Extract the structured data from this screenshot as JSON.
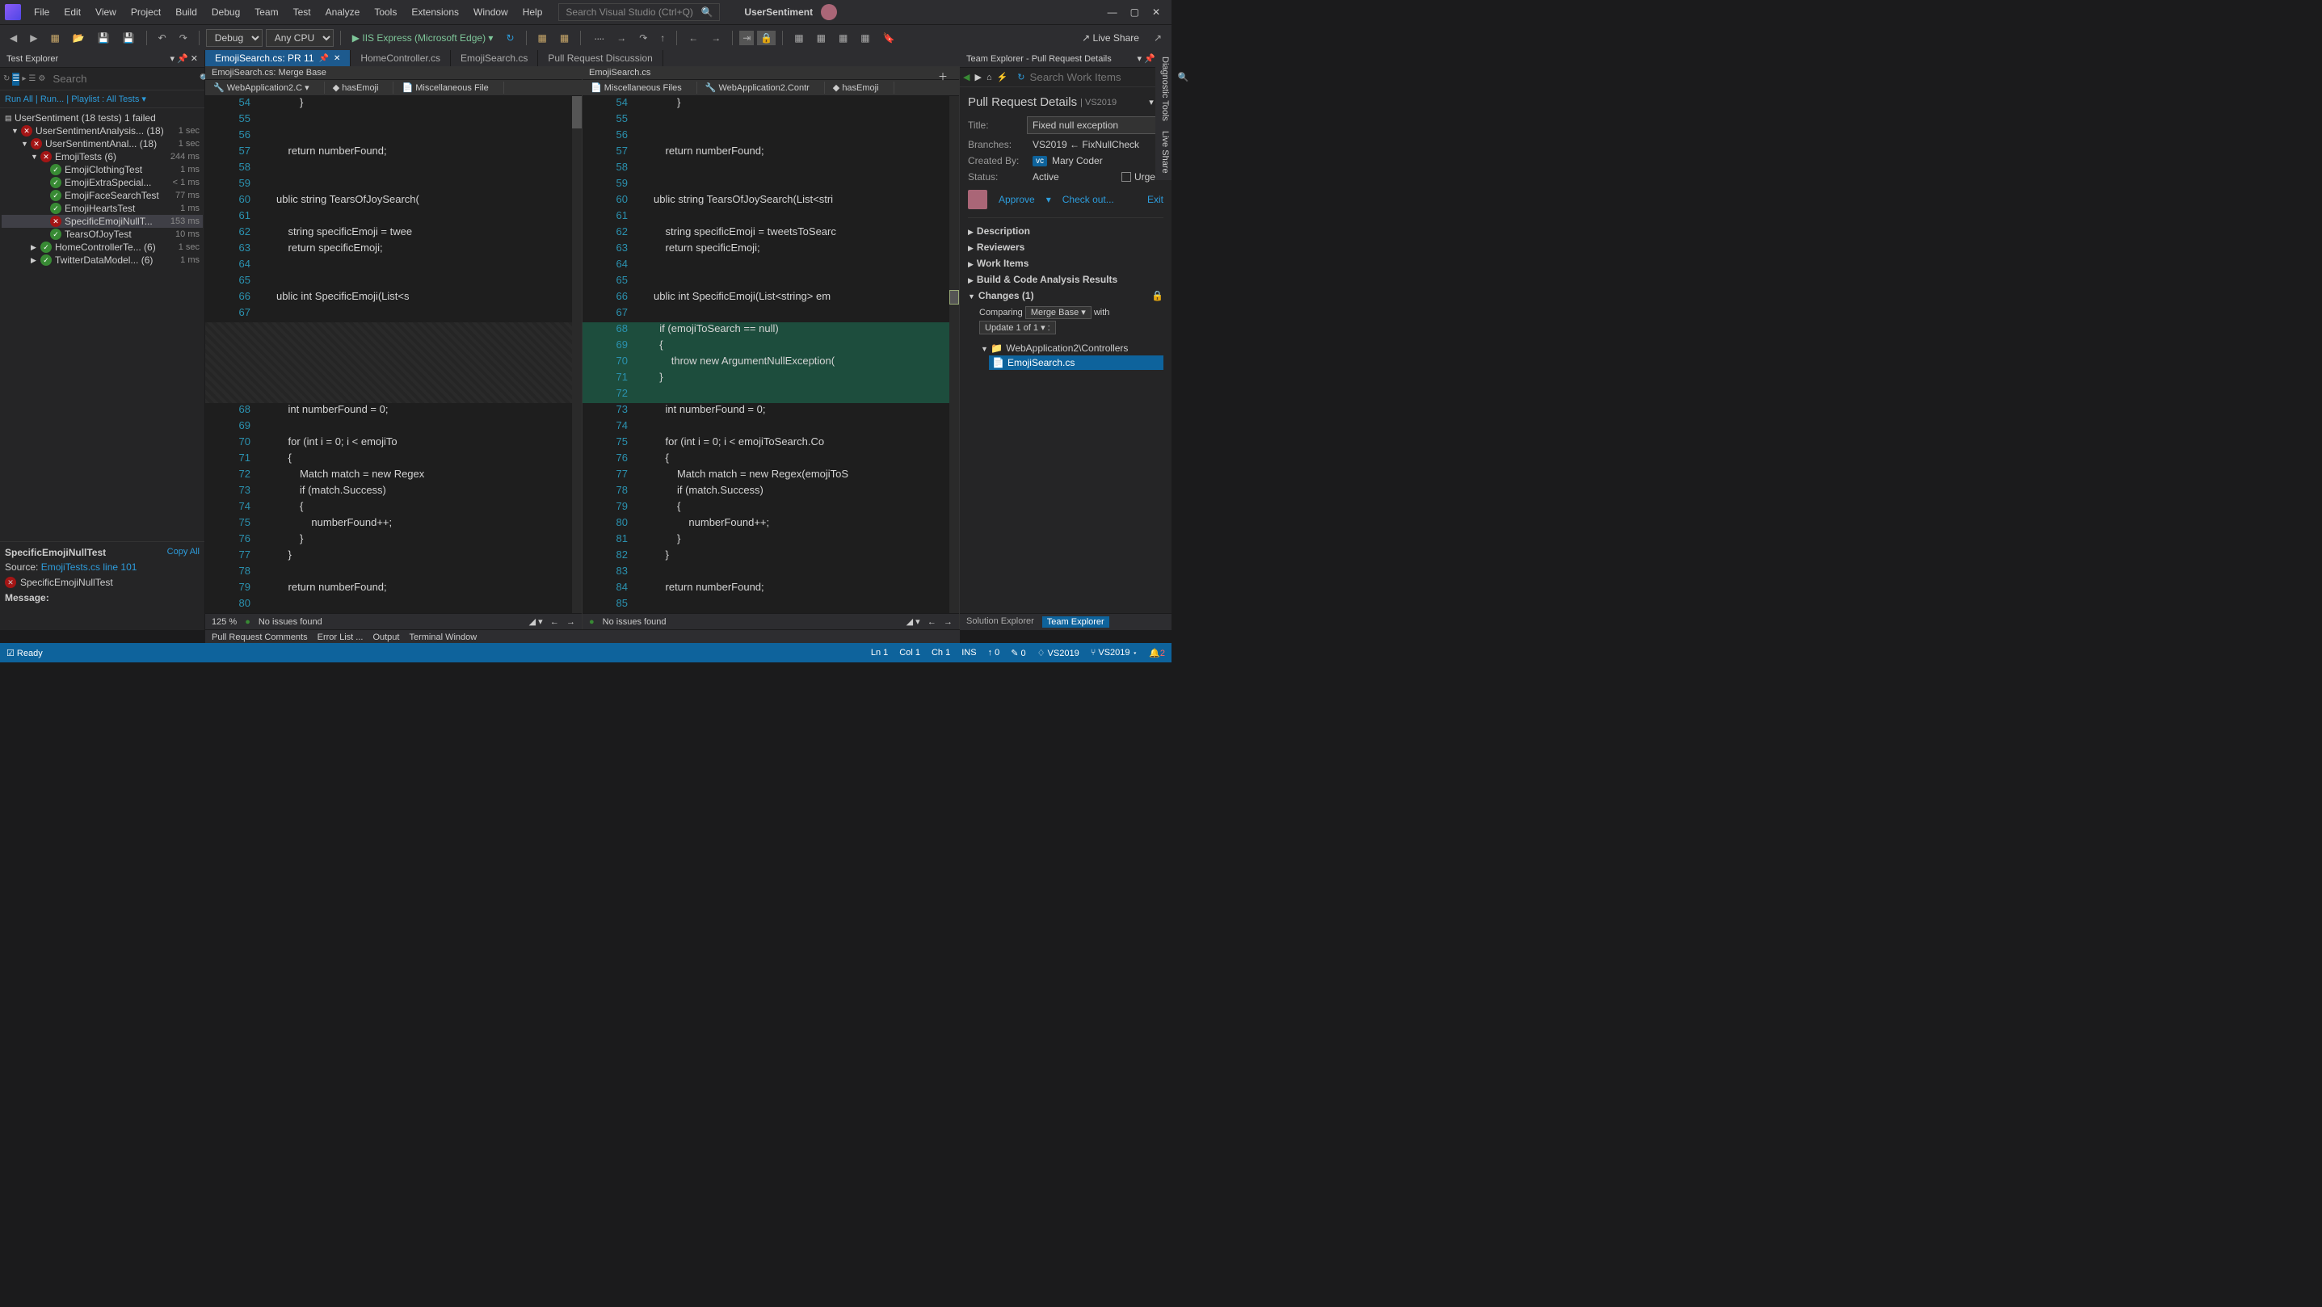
{
  "titlebar": {
    "menus": [
      "File",
      "Edit",
      "View",
      "Project",
      "Build",
      "Debug",
      "Team",
      "Test",
      "Analyze",
      "Tools",
      "Extensions",
      "Window",
      "Help"
    ],
    "search_placeholder": "Search Visual Studio (Ctrl+Q)",
    "project": "UserSentiment",
    "win_min": "—",
    "win_max": "▢",
    "win_close": "✕"
  },
  "toolbar": {
    "config": "Debug",
    "platform": "Any CPU",
    "start": "▶  IIS Express (Microsoft Edge)  ▾",
    "live_share": "↗ Live Share"
  },
  "test_explorer": {
    "title": "Test Explorer",
    "search_placeholder": "Search",
    "links": {
      "run_all": "Run All",
      "run": "Run...",
      "playlist": "Playlist : All Tests ▾"
    },
    "root": {
      "name": "UserSentiment (18 tests) 1 failed"
    },
    "nodes": [
      {
        "ind": 1,
        "exp": "▼",
        "st": "fail",
        "name": "UserSentimentAnalysis... (18)",
        "dur": "1 sec"
      },
      {
        "ind": 2,
        "exp": "▼",
        "st": "fail",
        "name": "UserSentimentAnal... (18)",
        "dur": "1 sec"
      },
      {
        "ind": 3,
        "exp": "▼",
        "st": "fail",
        "name": "EmojiTests (6)",
        "dur": "244 ms"
      },
      {
        "ind": 4,
        "exp": "",
        "st": "pass",
        "name": "EmojiClothingTest",
        "dur": "1 ms"
      },
      {
        "ind": 4,
        "exp": "",
        "st": "pass",
        "name": "EmojiExtraSpecial...",
        "dur": "< 1 ms"
      },
      {
        "ind": 4,
        "exp": "",
        "st": "pass",
        "name": "EmojiFaceSearchTest",
        "dur": "77 ms"
      },
      {
        "ind": 4,
        "exp": "",
        "st": "pass",
        "name": "EmojiHeartsTest",
        "dur": "1 ms"
      },
      {
        "ind": 4,
        "exp": "",
        "st": "fail",
        "name": "SpecificEmojiNullT...",
        "dur": "153 ms",
        "sel": true
      },
      {
        "ind": 4,
        "exp": "",
        "st": "pass",
        "name": "TearsOfJoyTest",
        "dur": "10 ms"
      },
      {
        "ind": 3,
        "exp": "▶",
        "st": "pass",
        "name": "HomeControllerTe... (6)",
        "dur": "1 sec"
      },
      {
        "ind": 3,
        "exp": "▶",
        "st": "pass",
        "name": "TwitterDataModel... (6)",
        "dur": "1 ms"
      }
    ],
    "detail": {
      "name": "SpecificEmojiNullTest",
      "copy": "Copy All",
      "source_lbl": "Source:  ",
      "source": "EmojiTests.cs line 101",
      "fail_name": "SpecificEmojiNullTest",
      "msg_lbl": "Message:"
    }
  },
  "tabs": [
    {
      "label": "EmojiSearch.cs: PR 11",
      "active": true,
      "pin": true
    },
    {
      "label": "HomeController.cs"
    },
    {
      "label": "EmojiSearch.cs"
    },
    {
      "label": "Pull Request Discussion"
    }
  ],
  "left_pane": {
    "head": "EmojiSearch.cs: Merge Base",
    "nav": [
      "📄 Miscellaneous File",
      "🔧 WebApplication2.C ▾",
      "◆ hasEmoji"
    ],
    "lines": [
      {
        "n": 54,
        "t": "             }"
      },
      {
        "n": 55,
        "t": ""
      },
      {
        "n": 56,
        "t": ""
      },
      {
        "n": 57,
        "t": "         return numberFound;"
      },
      {
        "n": 58,
        "t": ""
      },
      {
        "n": 59,
        "t": ""
      },
      {
        "n": 60,
        "h": "     ublic <kw>string</kw> <typ>TearsOfJoySearch</typ>("
      },
      {
        "n": 61,
        "t": ""
      },
      {
        "n": 62,
        "h": "         <kw>string</kw> specificEmoji = twee"
      },
      {
        "n": 63,
        "h": "         <kw>return</kw> specificEmoji;"
      },
      {
        "n": 64,
        "t": ""
      },
      {
        "n": 65,
        "t": ""
      },
      {
        "n": 66,
        "h": "     ublic <kw>int</kw> <typ>SpecificEmoji</typ>(<typ>List</typ>&lt;s"
      },
      {
        "n": 67,
        "t": ""
      },
      {
        "gap": true
      },
      {
        "n": 68,
        "h": "         <kw>int</kw> numberFound = 0;"
      },
      {
        "n": 69,
        "t": ""
      },
      {
        "n": 70,
        "h": "         <kw>for</kw> (<kw>int</kw> i = 0; i < emojiTo"
      },
      {
        "n": 71,
        "t": "         {"
      },
      {
        "n": 72,
        "h": "             <typ>Match</typ> match = <kw>new</kw> <typ>Rege</typ>x"
      },
      {
        "n": 73,
        "h": "             <kw>if</kw> (match.Success)"
      },
      {
        "n": 74,
        "t": "             {"
      },
      {
        "n": 75,
        "t": "                 numberFound++;"
      },
      {
        "n": 76,
        "t": "             }"
      },
      {
        "n": 77,
        "t": "         }"
      },
      {
        "n": 78,
        "t": ""
      },
      {
        "n": 79,
        "h": "         <kw>return</kw> numberFound;"
      },
      {
        "n": 80,
        "t": ""
      }
    ],
    "status": {
      "zoom": "125 %",
      "issues": "No issues found"
    }
  },
  "right_pane": {
    "head": "EmojiSearch.cs",
    "nav": [
      "📄 Miscellaneous Files",
      "🔧 WebApplication2.Contr",
      "◆ hasEmoji"
    ],
    "lines": [
      {
        "n": 54,
        "t": "             }"
      },
      {
        "n": 55,
        "t": ""
      },
      {
        "n": 56,
        "t": ""
      },
      {
        "n": 57,
        "t": "         return numberFound;"
      },
      {
        "n": 58,
        "t": ""
      },
      {
        "n": 59,
        "t": ""
      },
      {
        "n": 60,
        "h": "     ublic <kw>string</kw> <typ>TearsOfJoySearch</typ>(<typ>List</typ>&lt;stri"
      },
      {
        "n": 61,
        "t": ""
      },
      {
        "n": 62,
        "h": "         <kw>string</kw> specificEmoji = tweetsToSearc"
      },
      {
        "n": 63,
        "h": "         <kw>return</kw> specificEmoji;"
      },
      {
        "n": 64,
        "t": ""
      },
      {
        "n": 65,
        "t": ""
      },
      {
        "n": 66,
        "h": "     ublic <kw>int</kw> <typ>SpecificEmoji</typ>(<typ>List</typ>&lt;<kw>string</kw>&gt; em"
      },
      {
        "n": 67,
        "t": ""
      },
      {
        "n": 68,
        "add": true,
        "h": "       <kw>if</kw> (emojiToSearch == <kw>null</kw>)"
      },
      {
        "n": 69,
        "add": true,
        "t": "       {"
      },
      {
        "n": 70,
        "add": true,
        "h": "           <kw>throw</kw> <kw>new</kw> <typ>ArgumentNullException</typ>("
      },
      {
        "n": 71,
        "add": true,
        "t": "       }"
      },
      {
        "n": 72,
        "add": true,
        "t": ""
      },
      {
        "n": 73,
        "h": "         <kw>int</kw> numberFound = 0;"
      },
      {
        "n": 74,
        "t": ""
      },
      {
        "n": 75,
        "h": "         <kw>for</kw> (<kw>int</kw> i = 0; i < emojiToSearch.Co"
      },
      {
        "n": 76,
        "t": "         {"
      },
      {
        "n": 77,
        "h": "             <typ>Match</typ> match = <kw>new</kw> <typ>Regex</typ>(emojiToS"
      },
      {
        "n": 78,
        "h": "             <kw>if</kw> (match.Success)"
      },
      {
        "n": 79,
        "t": "             {"
      },
      {
        "n": 80,
        "t": "                 numberFound++;"
      },
      {
        "n": 81,
        "t": "             }"
      },
      {
        "n": 82,
        "t": "         }"
      },
      {
        "n": 83,
        "t": ""
      },
      {
        "n": 84,
        "h": "         <kw>return</kw> numberFound;"
      },
      {
        "n": 85,
        "t": ""
      }
    ],
    "status": {
      "issues": "No issues found"
    }
  },
  "team_explorer": {
    "title": "Team Explorer - Pull Request Details",
    "search_placeholder": "Search Work Items",
    "heading": "Pull Request Details",
    "heading_sub": "| VS2019",
    "title_lbl": "Title:",
    "title_val": "Fixed null exception",
    "branches_lbl": "Branches:",
    "branches_val": "VS2019 ← FixNullCheck",
    "created_lbl": "Created By:",
    "created_badge": "vc",
    "created_by": "Mary Coder",
    "status_lbl": "Status:",
    "status_val": "Active",
    "urgent": "Urgent",
    "approve": "Approve",
    "checkout": "Check out...",
    "exit": "Exit",
    "sections": [
      "Description",
      "Reviewers",
      "Work Items",
      "Build & Code Analysis Results"
    ],
    "changes": "Changes (1)",
    "comparing": "Comparing",
    "compare_mode": "Merge Base ▾",
    "with": "with",
    "update": "Update 1 of 1 ▾ :",
    "folder": "WebApplication2\\Controllers",
    "file": "EmojiSearch.cs",
    "bottom_tabs": [
      "Solution Explorer",
      "Team Explorer"
    ]
  },
  "output_tabs": [
    "Pull Request Comments",
    "Error List ...",
    "Output",
    "Terminal Window"
  ],
  "statusbar": {
    "ready": "☑  Ready",
    "ln": "Ln 1",
    "col": "Col 1",
    "ch": "Ch 1",
    "ins": "INS",
    "up": "↑ 0",
    "pub": "✎ 0",
    "branch": "♢ VS2019",
    "branch2": "⑂ VS2019 ▾",
    "bell": "🔔2"
  },
  "vert_tabs": [
    "Diagnostic Tools",
    "Live Share"
  ]
}
